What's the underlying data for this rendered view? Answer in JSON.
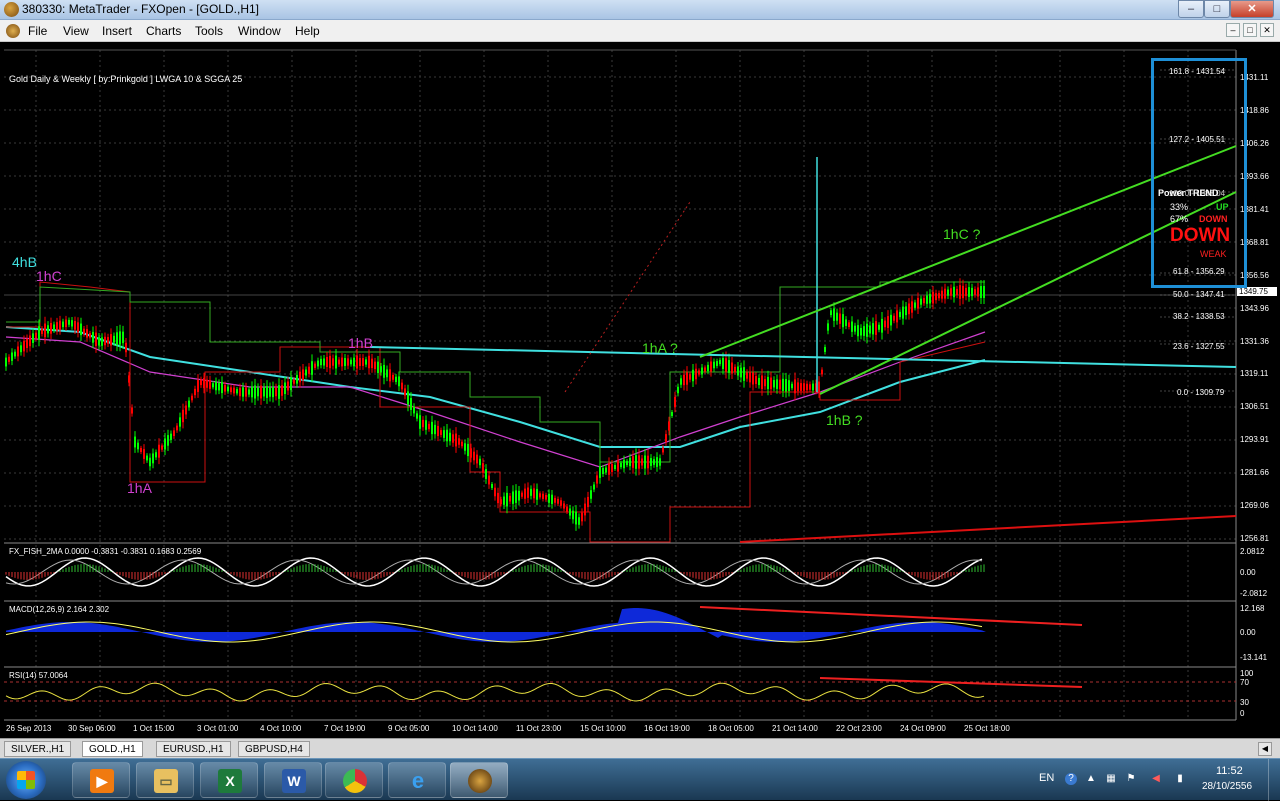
{
  "window": {
    "title": "380330: MetaTrader - FXOpen - [GOLD.,H1]",
    "controls": [
      "–",
      "□",
      "✕"
    ]
  },
  "menu": {
    "items": [
      "File",
      "View",
      "Insert",
      "Charts",
      "Tools",
      "Window",
      "Help"
    ],
    "mdi_controls": [
      "–",
      "□",
      "✕"
    ]
  },
  "chart": {
    "header": "Gold Daily & Weekly [ by:Prinkgold ] LWGA 10  &  SGGA 25",
    "current_price": "1349.75",
    "price_axis": [
      "1431.11",
      "1418.86",
      "1406.26",
      "1393.66",
      "1381.41",
      "1368.81",
      "1356.56",
      "1343.96",
      "1331.36",
      "1319.11",
      "1306.51",
      "1293.91",
      "1281.66",
      "1269.06",
      "1256.81"
    ],
    "time_axis": [
      "26 Sep 2013",
      "30 Sep 06:00",
      "1 Oct 15:00",
      "3 Oct 01:00",
      "4 Oct 10:00",
      "7 Oct 19:00",
      "9 Oct 05:00",
      "10 Oct 14:00",
      "11 Oct 23:00",
      "15 Oct 10:00",
      "16 Oct 19:00",
      "18 Oct 05:00",
      "21 Oct 14:00",
      "22 Oct 23:00",
      "24 Oct 09:00",
      "25 Oct 18:00"
    ],
    "wave_labels": {
      "w4hB": "4hB",
      "w1hC_left": "1hC",
      "w1hA_left": "1hA",
      "w1hB_left": "1hB",
      "w1hA_q": "1hA ?",
      "w1hB_q": "1hB ?",
      "w1hC_q": "1hC ?"
    },
    "fib_levels": [
      "161.8 - 1431.54",
      "127.2 - 1405.51",
      "100.0 - 1385.04",
      "61.8 - 1356.29",
      "50.0 - 1347.41",
      "38.2 - 1338.53",
      "23.6 - 1327.55",
      "0.0 - 1309.79"
    ],
    "trend_panel": {
      "header": "Power TREND",
      "rows": [
        {
          "pct": "33%",
          "label": "UP"
        },
        {
          "pct": "67%",
          "label": "DOWN"
        }
      ],
      "big": "DOWN",
      "strength": "WEAK"
    }
  },
  "indicators": {
    "fish": {
      "label": "FX_FISH_2MA 0.0000 -0.3831 -0.3831 0.1683 0.2569",
      "axis": [
        "2.0812",
        "0.00",
        "-2.0812"
      ]
    },
    "macd": {
      "label": "MACD(12,26,9) 2.164 2.302",
      "axis": [
        "12.168",
        "0.00",
        "-13.141"
      ]
    },
    "rsi": {
      "label": "RSI(14) 57.0064",
      "axis": [
        "100",
        "70",
        "30",
        "0"
      ]
    }
  },
  "tabs": [
    "SILVER.,H1",
    "GOLD.,H1",
    "EURUSD.,H1",
    "GBPUSD,H4"
  ],
  "active_tab": "GOLD.,H1",
  "tray": {
    "lang": "EN",
    "time": "11:52",
    "date": "28/10/2556"
  },
  "colors": {
    "bull": "#00ff00",
    "bear": "#ff0000",
    "ma_cyan": "#40e0e0",
    "ma_magenta": "#d040d0",
    "fib_box": "#1e8fd6",
    "channel": "#44dd22"
  }
}
